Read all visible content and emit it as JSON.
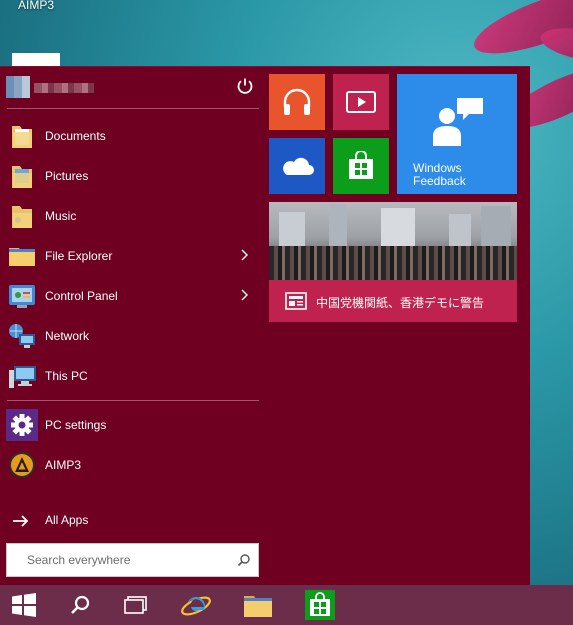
{
  "desktop": {
    "shortcut_label": "AIMP3"
  },
  "start_menu": {
    "items": [
      {
        "label": "Documents",
        "icon": "documents-folder-icon"
      },
      {
        "label": "Pictures",
        "icon": "pictures-folder-icon"
      },
      {
        "label": "Music",
        "icon": "music-folder-icon"
      },
      {
        "label": "File Explorer",
        "icon": "file-explorer-icon",
        "has_submenu": true
      },
      {
        "label": "Control Panel",
        "icon": "control-panel-icon",
        "has_submenu": true
      },
      {
        "label": "Network",
        "icon": "network-icon"
      },
      {
        "label": "This PC",
        "icon": "this-pc-icon"
      }
    ],
    "pinned": [
      {
        "label": "PC settings",
        "icon": "gear-icon"
      },
      {
        "label": "AIMP3",
        "icon": "aimp-icon"
      }
    ],
    "all_apps_label": "All Apps",
    "search_placeholder": "Search everywhere"
  },
  "tiles": {
    "feedback_label": "Windows\nFeedback",
    "news_headline": "中国党機関紙、香港デモに警告"
  },
  "colors": {
    "menu_bg": "#6f0022",
    "music_tile": "#e8552d",
    "video_tile": "#c0224f",
    "feedback_tile": "#2d8bea",
    "onedrive_tile": "#1d58c4",
    "store_tile": "#0c9d1a",
    "taskbar": "#6b2d49"
  }
}
